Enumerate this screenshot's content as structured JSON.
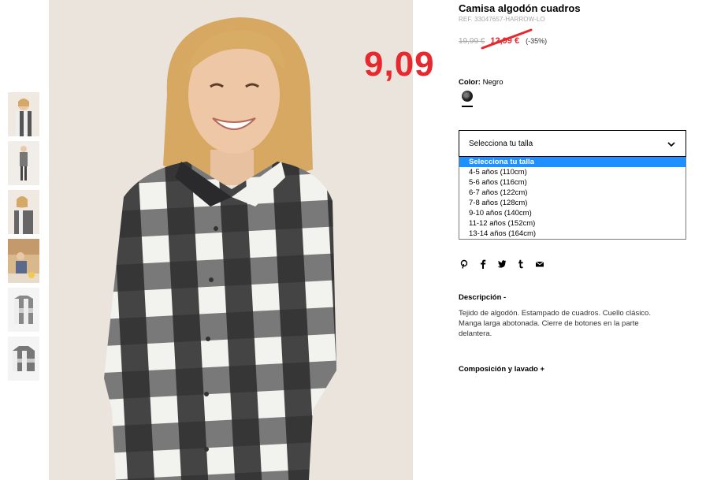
{
  "product": {
    "title": "Camisa algodón cuadros",
    "ref": "REF. 33047657-HARROW-LO",
    "price_old": "19,99 €",
    "price_sale": "12,99 €",
    "discount": "(-35%)",
    "annotation": "9,09",
    "color_label": "Color:",
    "color_value": "Negro"
  },
  "size_selector": {
    "placeholder": "Selecciona tu talla",
    "options": [
      "Selecciona tu talla",
      "4-5 años (110cm)",
      "5-6 años (116cm)",
      "6-7 años (122cm)",
      "7-8 años (128cm)",
      "9-10 años (140cm)",
      "11-12 años (152cm)",
      "13-14 años (164cm)"
    ],
    "selected_index": 0
  },
  "share": {
    "icons": [
      "pinterest-icon",
      "facebook-icon",
      "twitter-icon",
      "tumblr-icon",
      "email-icon"
    ]
  },
  "description": {
    "title": "Descripción -",
    "text": "Tejido de algodón. Estampado de cuadros. Cuello clásico. Manga larga abotonada. Cierre de botones en la parte delantera."
  },
  "composition": {
    "title": "Composición y lavado +"
  },
  "colors": {
    "sale_red": "#e8282f",
    "select_blue": "#1e90ff"
  }
}
